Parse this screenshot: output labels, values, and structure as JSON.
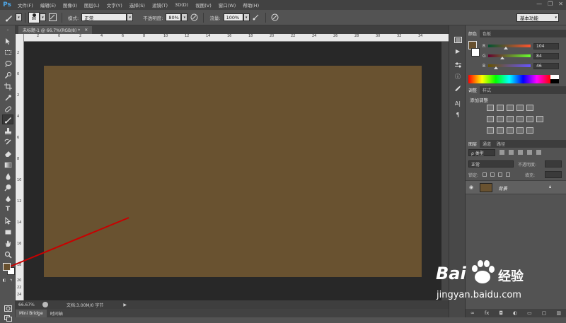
{
  "app": {
    "logo": "Ps"
  },
  "menu": [
    "文件(F)",
    "编辑(E)",
    "图像(I)",
    "图层(L)",
    "文字(Y)",
    "选择(S)",
    "滤镜(T)",
    "3D(D)",
    "视图(V)",
    "窗口(W)",
    "帮助(H)"
  ],
  "window_controls": {
    "minimize": "—",
    "restore": "❐",
    "close": "✕"
  },
  "options": {
    "brush_size": "80",
    "mode_label": "模式:",
    "mode_value": "正常",
    "opacity_label": "不透明度:",
    "opacity_value": "80%",
    "flow_label": "流量:",
    "flow_value": "100%",
    "workspace": "基本功能"
  },
  "document": {
    "tab_title": "未标题-1 @ 66.7%(RGB/8) *",
    "tab_close": "×",
    "canvas_color": "#695230",
    "ruler_top": [
      "2",
      "0",
      "2",
      "4",
      "6",
      "8",
      "10",
      "12",
      "14",
      "16",
      "18",
      "20",
      "22",
      "24",
      "26",
      "28",
      "30",
      "32",
      "34"
    ],
    "ruler_left": [
      "2",
      "0",
      "2",
      "4",
      "6",
      "8",
      "10",
      "12",
      "14",
      "16",
      "18",
      "20",
      "22",
      "24"
    ]
  },
  "status": {
    "zoom": "66.67%",
    "doc_info": "文档:3.00M/0 字节"
  },
  "bottom_tabs": [
    "Mini Bridge",
    "时间轴"
  ],
  "color_panel": {
    "tabs": [
      "颜色",
      "色板"
    ],
    "r_label": "R",
    "r_value": "104",
    "g_label": "G",
    "g_value": "84",
    "b_label": "B",
    "b_value": "46",
    "foreground": "#68502e"
  },
  "adjustments_panel": {
    "tabs": [
      "调整",
      "样式"
    ],
    "title": "添加调整"
  },
  "layers_panel": {
    "tabs": [
      "图层",
      "通道",
      "路径"
    ],
    "filter_label": "ρ 类型",
    "blend_mode": "正常",
    "opacity_label": "不透明度:",
    "lock_label": "锁定:",
    "fill_label": "填充:",
    "layer_name": "背景"
  },
  "watermark": {
    "brand": "Bai",
    "brand2": "经验",
    "url": "jingyan.baidu.com"
  }
}
